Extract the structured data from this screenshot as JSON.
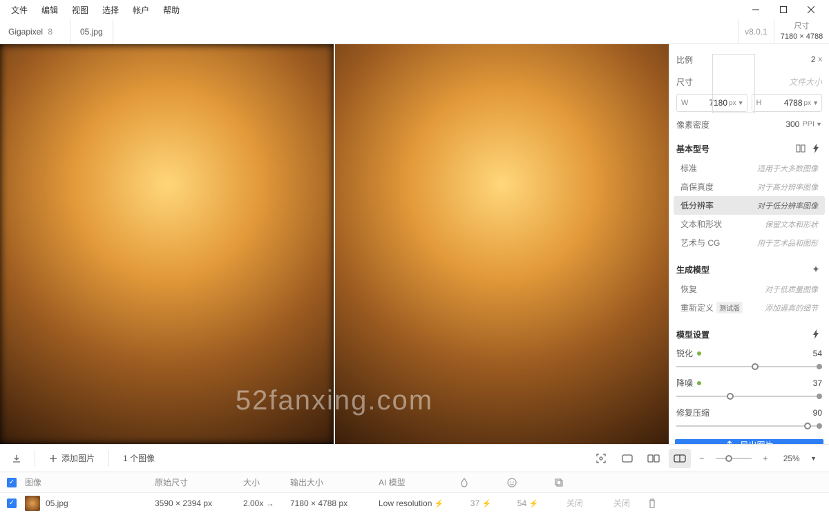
{
  "menu": {
    "file": "文件",
    "edit": "编辑",
    "view": "视图",
    "select": "选择",
    "account": "帐户",
    "help": "帮助"
  },
  "app": {
    "name": "Gigapixel",
    "major": "8",
    "version": "v8.0.1"
  },
  "tab": {
    "filename": "05.jpg"
  },
  "dim_label": "尺寸",
  "dim_value": "7180 × 4788",
  "watermark": "52fanxing.com",
  "panel": {
    "ratio": {
      "label": "比例",
      "value": "2",
      "unit": "x"
    },
    "size_label": "尺寸",
    "filesize_label": "文件大小",
    "width": {
      "label": "W",
      "value": "7180",
      "unit": "px"
    },
    "height": {
      "label": "H",
      "value": "4788",
      "unit": "px"
    },
    "ppi": {
      "label": "像素密度",
      "value": "300",
      "unit": "PPI"
    },
    "basic_model": "基本型号",
    "models": [
      {
        "name": "标准",
        "desc": "适用于大多数图像"
      },
      {
        "name": "高保真度",
        "desc": "对于高分辨率图像"
      },
      {
        "name": "低分辨率",
        "desc": "对于低分辨率图像"
      },
      {
        "name": "文本和形状",
        "desc": "保留文本和形状"
      },
      {
        "name": "艺术与 CG",
        "desc": "用于艺术品和图形"
      }
    ],
    "gen_model": "生成模型",
    "gen_items": [
      {
        "name": "恢复",
        "desc": "对于低质量图像"
      },
      {
        "name": "重新定义",
        "badge": "测试版",
        "desc": "添加逼真的细节"
      }
    ],
    "model_settings": "模型设置",
    "sharpen": {
      "label": "锐化",
      "value": "54"
    },
    "denoise": {
      "label": "降噪",
      "value": "37"
    },
    "compress": {
      "label": "修复压缩",
      "value": "90"
    },
    "export": "导出图片"
  },
  "toolbar": {
    "add_image": "添加图片",
    "image_count": "1 个图像",
    "zoom": "25%"
  },
  "table": {
    "headers": {
      "image": "图像",
      "orig": "原始尺寸",
      "size": "大小",
      "out": "输出大小",
      "model": "AI 模型"
    },
    "row": {
      "name": "05.jpg",
      "orig": "3590 × 2394 px",
      "scale": "2.00x →",
      "out": "7180 × 4788 px",
      "model": "Low resolution",
      "denoise": "37",
      "sharpen": "54",
      "off1": "关闭",
      "off2": "关闭"
    }
  }
}
